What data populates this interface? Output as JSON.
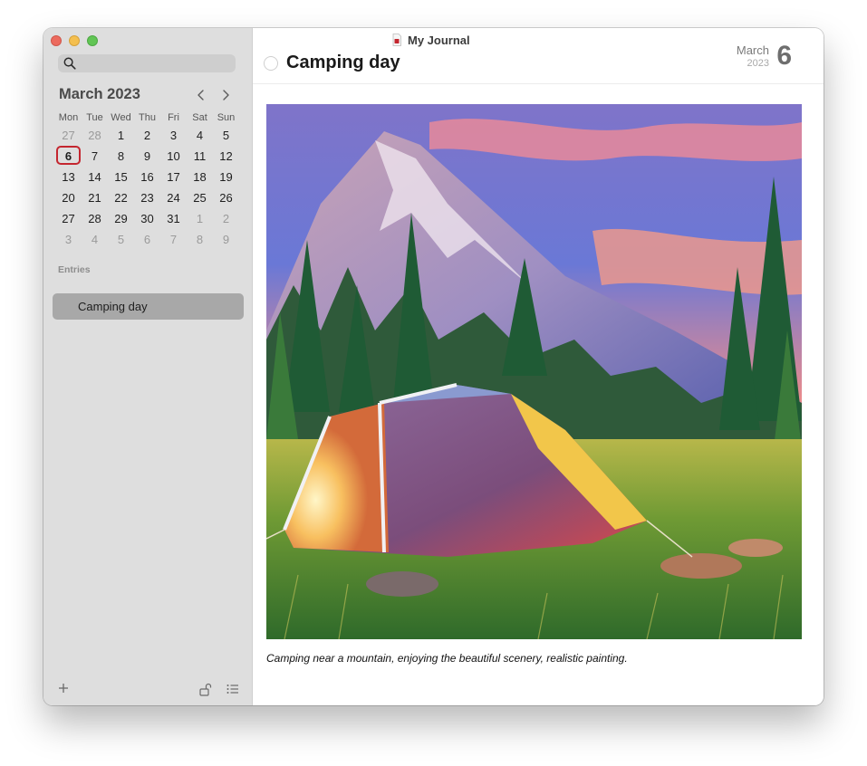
{
  "app": {
    "title": "My Journal"
  },
  "sidebar": {
    "search_placeholder": "",
    "calendar": {
      "month_title": "March 2023",
      "weekdays": [
        "Mon",
        "Tue",
        "Wed",
        "Thu",
        "Fri",
        "Sat",
        "Sun"
      ],
      "weeks": [
        [
          "27",
          "28",
          "1",
          "2",
          "3",
          "4",
          "5"
        ],
        [
          "6",
          "7",
          "8",
          "9",
          "10",
          "11",
          "12"
        ],
        [
          "13",
          "14",
          "15",
          "16",
          "17",
          "18",
          "19"
        ],
        [
          "20",
          "21",
          "22",
          "23",
          "24",
          "25",
          "26"
        ],
        [
          "27",
          "28",
          "29",
          "30",
          "31",
          "1",
          "2"
        ],
        [
          "3",
          "4",
          "5",
          "6",
          "7",
          "8",
          "9"
        ]
      ],
      "selected_day": "6"
    },
    "entries_label": "Entries",
    "entries": [
      {
        "title": "Camping day"
      }
    ]
  },
  "entry": {
    "title": "Camping day",
    "date_month": "March",
    "date_year": "2023",
    "date_day": "6",
    "image_caption": "Camping near a mountain, enjoying the beautiful scenery, realistic painting."
  },
  "colors": {
    "today_ring": "#c4262f",
    "selected_entry": "#a8a8a8",
    "sidebar_bg": "#dedede"
  }
}
